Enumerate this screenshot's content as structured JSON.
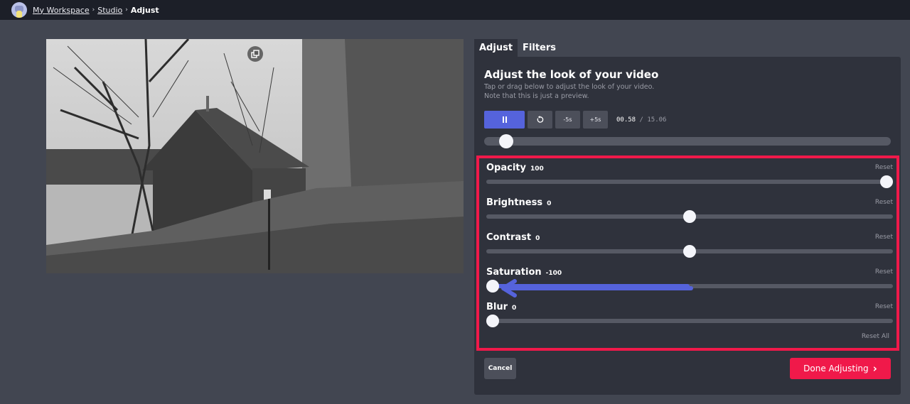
{
  "breadcrumb": {
    "items": [
      {
        "label": "My Workspace"
      },
      {
        "label": "Studio"
      }
    ],
    "current": "Adjust",
    "separator": "›"
  },
  "tabs": [
    {
      "label": "Adjust",
      "active": true
    },
    {
      "label": "Filters",
      "active": false
    }
  ],
  "panel": {
    "title": "Adjust the look of your video",
    "subtitle_line1": "Tap or drag below to adjust the look of your video.",
    "subtitle_line2": "Note that this is just a preview."
  },
  "player": {
    "pause_icon": "pause-icon",
    "restart_icon": "restart-icon",
    "back_label": "-5s",
    "forward_label": "+5s",
    "current_time": "00.58",
    "separator": "/",
    "duration": "15.06",
    "progress_fraction": 0.0385
  },
  "adjustments": [
    {
      "label": "Opacity",
      "value": "100",
      "min": 0,
      "max": 100,
      "num": 100,
      "reset": "Reset"
    },
    {
      "label": "Brightness",
      "value": "0",
      "min": -100,
      "max": 100,
      "num": 0,
      "reset": "Reset"
    },
    {
      "label": "Contrast",
      "value": "0",
      "min": -100,
      "max": 100,
      "num": 0,
      "reset": "Reset"
    },
    {
      "label": "Saturation",
      "value": "-100",
      "min": -100,
      "max": 100,
      "num": -100,
      "reset": "Reset"
    },
    {
      "label": "Blur",
      "value": "0",
      "min": 0,
      "max": 100,
      "num": 0,
      "reset": "Reset"
    }
  ],
  "reset_all": "Reset All",
  "buttons": {
    "cancel": "Cancel",
    "done": "Done Adjusting",
    "done_icon": "›"
  },
  "colors": {
    "accent": "#5563dc",
    "primary": "#f0194a",
    "highlight_box": "#f0194a"
  }
}
